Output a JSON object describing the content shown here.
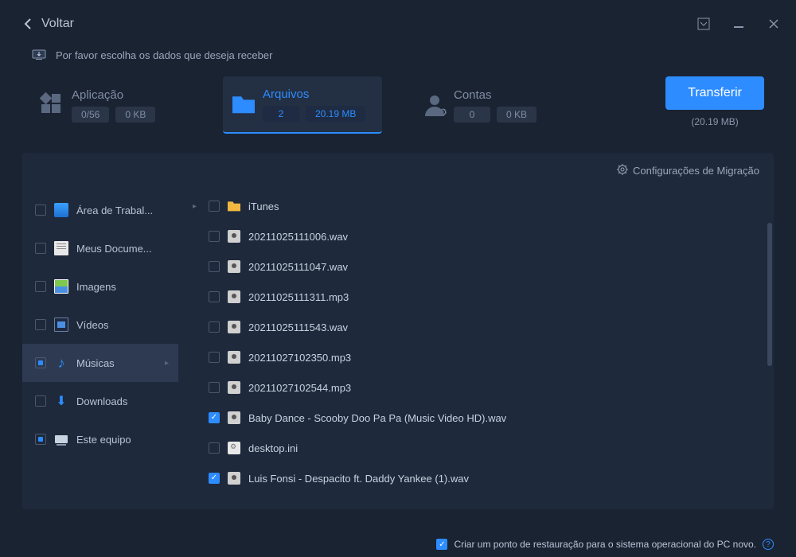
{
  "titlebar": {
    "back": "Voltar"
  },
  "instruction": "Por favor escolha os dados que deseja receber",
  "tabs": {
    "app": {
      "title": "Aplicação",
      "stat1": "0/56",
      "stat2": "0 KB"
    },
    "files": {
      "title": "Arquivos",
      "stat1": "2",
      "stat2": "20.19 MB"
    },
    "acct": {
      "title": "Contas",
      "stat1": "0",
      "stat2": "0 KB"
    }
  },
  "transfer": {
    "button": "Transferir",
    "size": "(20.19 MB)"
  },
  "panel": {
    "settings": "Configurações de Migração"
  },
  "sidebar": [
    {
      "label": "Área de Trabal...",
      "icon": "desktop",
      "check": "none",
      "selected": false
    },
    {
      "label": "Meus Docume...",
      "icon": "doc",
      "check": "none",
      "selected": false
    },
    {
      "label": "Imagens",
      "icon": "img",
      "check": "none",
      "selected": false
    },
    {
      "label": "Vídeos",
      "icon": "video",
      "check": "none",
      "selected": false
    },
    {
      "label": "Músicas",
      "icon": "music",
      "check": "partial",
      "selected": true,
      "expand": true
    },
    {
      "label": "Downloads",
      "icon": "download",
      "check": "none",
      "selected": false
    },
    {
      "label": "Este equipo",
      "icon": "pc",
      "check": "partial",
      "selected": false
    }
  ],
  "files": [
    {
      "name": "iTunes",
      "icon": "folder",
      "checked": false,
      "expand": true
    },
    {
      "name": "20211025111006.wav",
      "icon": "audio",
      "checked": false
    },
    {
      "name": "20211025111047.wav",
      "icon": "audio",
      "checked": false
    },
    {
      "name": "20211025111311.mp3",
      "icon": "audio",
      "checked": false
    },
    {
      "name": "20211025111543.wav",
      "icon": "audio",
      "checked": false
    },
    {
      "name": "20211027102350.mp3",
      "icon": "audio",
      "checked": false
    },
    {
      "name": "20211027102544.mp3",
      "icon": "audio",
      "checked": false
    },
    {
      "name": "Baby Dance - Scooby Doo Pa Pa (Music Video HD).wav",
      "icon": "audio",
      "checked": true
    },
    {
      "name": "desktop.ini",
      "icon": "ini",
      "checked": false
    },
    {
      "name": "Luis Fonsi - Despacito ft. Daddy Yankee (1).wav",
      "icon": "audio",
      "checked": true
    }
  ],
  "footer": {
    "text": "Criar um ponto de restauração para o sistema operacional do PC novo."
  }
}
